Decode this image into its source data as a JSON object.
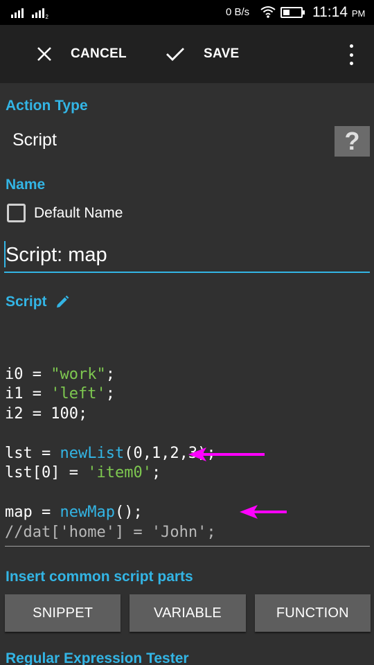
{
  "status_bar": {
    "network_speed": "0 B/s",
    "time": "11:14",
    "ampm": "PM",
    "sim2_label": "2"
  },
  "toolbar": {
    "cancel_label": "CANCEL",
    "save_label": "SAVE"
  },
  "action_type": {
    "label": "Action Type",
    "value": "Script",
    "help_symbol": "?"
  },
  "name": {
    "label": "Name",
    "checkbox_label": "Default Name",
    "checkbox_checked": false,
    "input_value": "Script: map"
  },
  "script": {
    "label": "Script",
    "lines": [
      [],
      [
        [
          "t",
          "i0 = "
        ],
        [
          "s",
          "\"work\""
        ],
        [
          "t",
          ";"
        ]
      ],
      [
        [
          "t",
          "i1 = "
        ],
        [
          "s",
          "'left'"
        ],
        [
          "t",
          ";"
        ]
      ],
      [
        [
          "t",
          "i2 = 100;"
        ]
      ],
      [],
      [
        [
          "t",
          "lst = "
        ],
        [
          "f",
          "newList"
        ],
        [
          "t",
          "(0,1,2,3);"
        ]
      ],
      [
        [
          "t",
          "lst[0] = "
        ],
        [
          "s",
          "'item0'"
        ],
        [
          "t",
          ";"
        ]
      ],
      [],
      [
        [
          "t",
          "map = "
        ],
        [
          "f",
          "newMap"
        ],
        [
          "t",
          "();"
        ]
      ],
      [
        [
          "c",
          "//dat['home'] = 'John';"
        ]
      ]
    ]
  },
  "insert_section": {
    "label": "Insert common script parts",
    "buttons": [
      "SNIPPET",
      "VARIABLE",
      "FUNCTION"
    ]
  },
  "regex_section": {
    "label": "Regular Expression Tester"
  },
  "colors": {
    "accent": "#33b5e5",
    "string": "#7ec850",
    "annotation_arrow": "#ff00ff",
    "background": "#303030",
    "toolbar": "#212121"
  }
}
